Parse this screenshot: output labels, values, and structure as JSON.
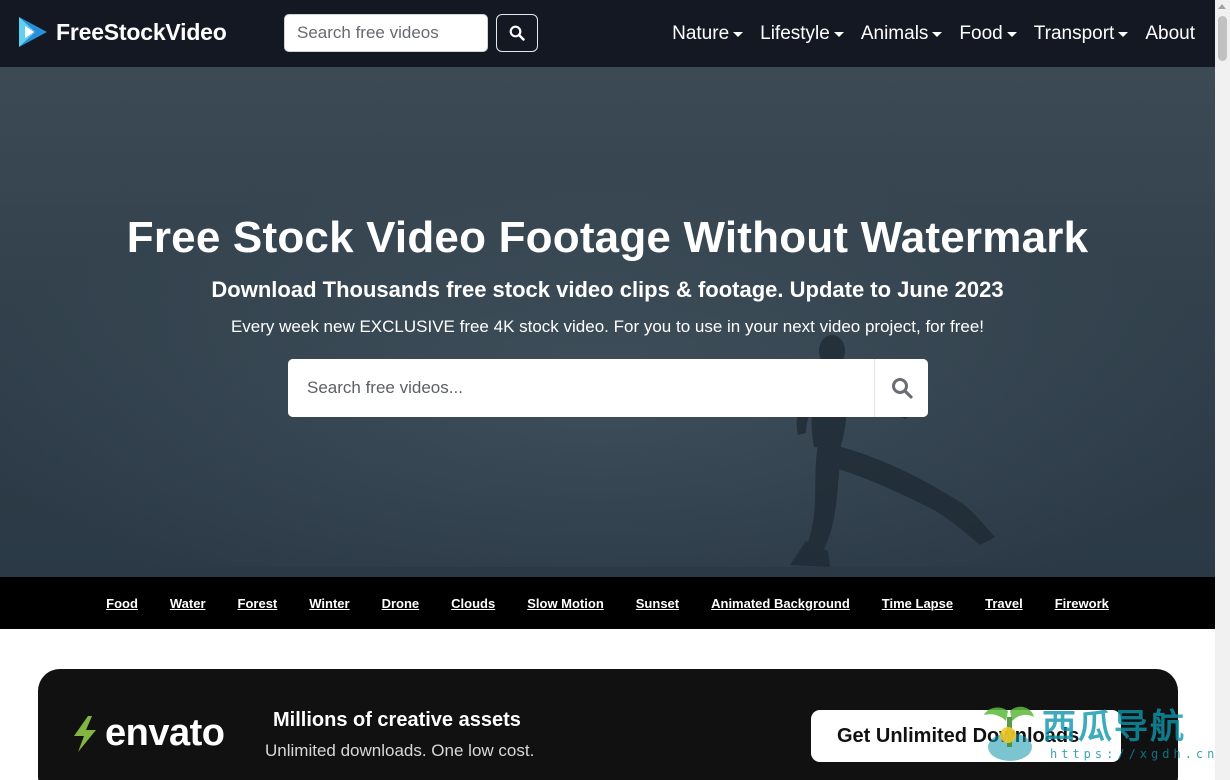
{
  "header": {
    "brand": "FreeStockVideo",
    "search_placeholder": "Search free videos",
    "menu": [
      {
        "label": "Nature",
        "has_dropdown": true
      },
      {
        "label": "Lifestyle",
        "has_dropdown": true
      },
      {
        "label": "Animals",
        "has_dropdown": true
      },
      {
        "label": "Food",
        "has_dropdown": true
      },
      {
        "label": "Transport",
        "has_dropdown": true
      },
      {
        "label": "About",
        "has_dropdown": false
      }
    ]
  },
  "hero": {
    "title": "Free Stock Video Footage Without Watermark",
    "subtitle": "Download Thousands free stock video clips & footage. Update to June 2023",
    "tagline": "Every week new EXCLUSIVE free 4K stock video. For you to use in your next video project, for free!",
    "search_placeholder": "Search free videos..."
  },
  "tags": [
    "Food",
    "Water",
    "Forest",
    "Winter",
    "Drone",
    "Clouds",
    "Slow Motion",
    "Sunset",
    "Animated Background",
    "Time Lapse",
    "Travel",
    "Firework"
  ],
  "banner": {
    "brand": "envato",
    "title": "Millions of creative assets",
    "subtitle": "Unlimited downloads. One low cost.",
    "cta": "Get Unlimited Downloads"
  },
  "watermark": {
    "text": "西瓜导航",
    "url": "https://xgdh.cn"
  },
  "colors": {
    "navbar_bg": "#141822",
    "hero_bg": "#34434e",
    "tagbar_bg": "#000000",
    "banner_bg": "#111111",
    "envato_green": "#82b541"
  },
  "icons": {
    "search": "search-icon",
    "dropdown": "caret-down-icon"
  }
}
